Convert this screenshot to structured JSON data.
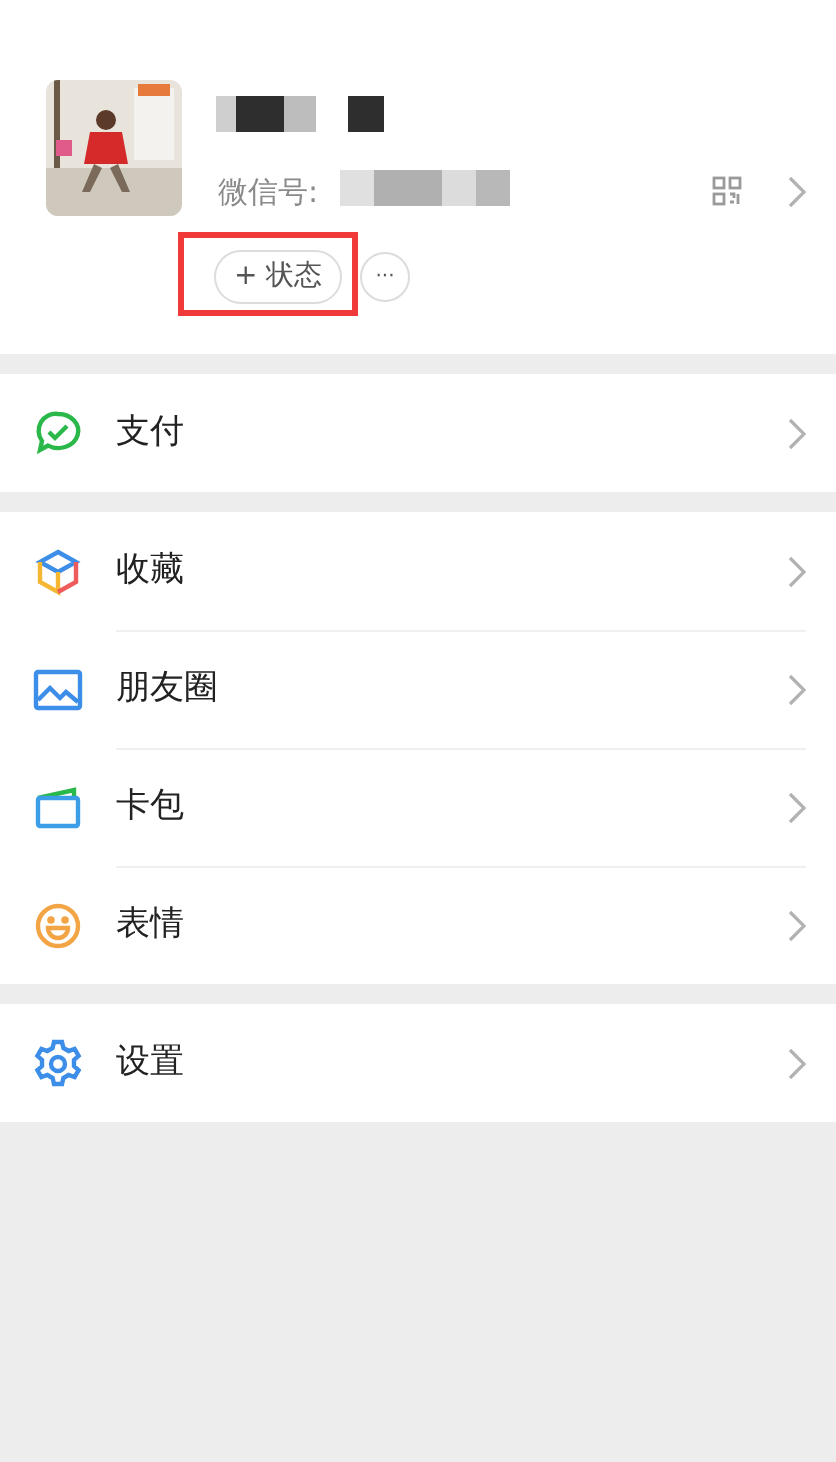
{
  "profile": {
    "wechat_id_label": "微信号:",
    "status_button": "+ 状态",
    "more_button": "···",
    "highlighted": true
  },
  "groups": [
    {
      "items": [
        {
          "kind": "pay",
          "label": "支付"
        }
      ]
    },
    {
      "items": [
        {
          "kind": "favorites",
          "label": "收藏"
        },
        {
          "kind": "moments",
          "label": "朋友圈"
        },
        {
          "kind": "cards",
          "label": "卡包"
        },
        {
          "kind": "stickers",
          "label": "表情"
        }
      ]
    },
    {
      "items": [
        {
          "kind": "settings",
          "label": "设置"
        }
      ]
    }
  ]
}
